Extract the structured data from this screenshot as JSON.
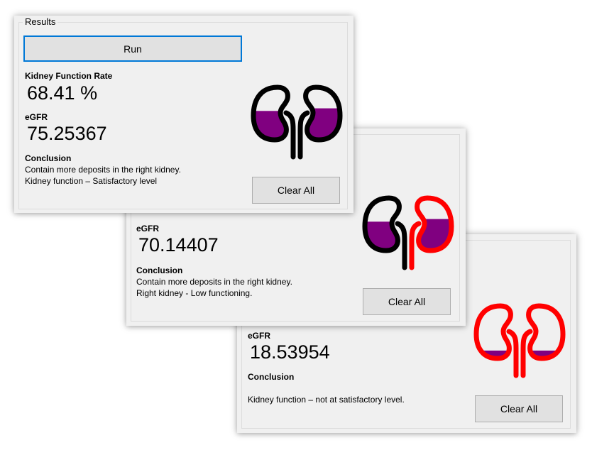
{
  "panel1": {
    "group_title": "Results",
    "run_label": "Run",
    "rate_label": "Kidney Function Rate",
    "rate_value": "68.41 %",
    "egfr_label": "eGFR",
    "egfr_value": "75.25367",
    "conclusion_label": "Conclusion",
    "conclusion_line1": "Contain more deposits in the right kidney.",
    "conclusion_line2": "Kidney function – Satisfactory level",
    "clear_label": "Clear All",
    "kidney": {
      "left_outline": "#000000",
      "right_outline": "#000000",
      "fill": "#800080",
      "left_fill_level": 0.55,
      "right_fill_level": 0.6
    }
  },
  "panel2": {
    "egfr_label": "eGFR",
    "egfr_value": "70.14407",
    "conclusion_label": "Conclusion",
    "conclusion_line1": "Contain more deposits in the right kidney.",
    "conclusion_line2": "Right kidney - Low functioning.",
    "clear_label": "Clear All",
    "kidney": {
      "left_outline": "#000000",
      "right_outline": "#ff0000",
      "fill": "#800080",
      "left_fill_level": 0.55,
      "right_fill_level": 0.6
    }
  },
  "panel3": {
    "egfr_label": "eGFR",
    "egfr_value": "18.53954",
    "conclusion_label": "Conclusion",
    "conclusion_line1": "",
    "conclusion_line2": "Kidney function – not at satisfactory level.",
    "clear_label": "Clear All",
    "kidney": {
      "left_outline": "#ff0000",
      "right_outline": "#ff0000",
      "fill": "#800080",
      "left_fill_level": 0.15,
      "right_fill_level": 0.15
    }
  }
}
